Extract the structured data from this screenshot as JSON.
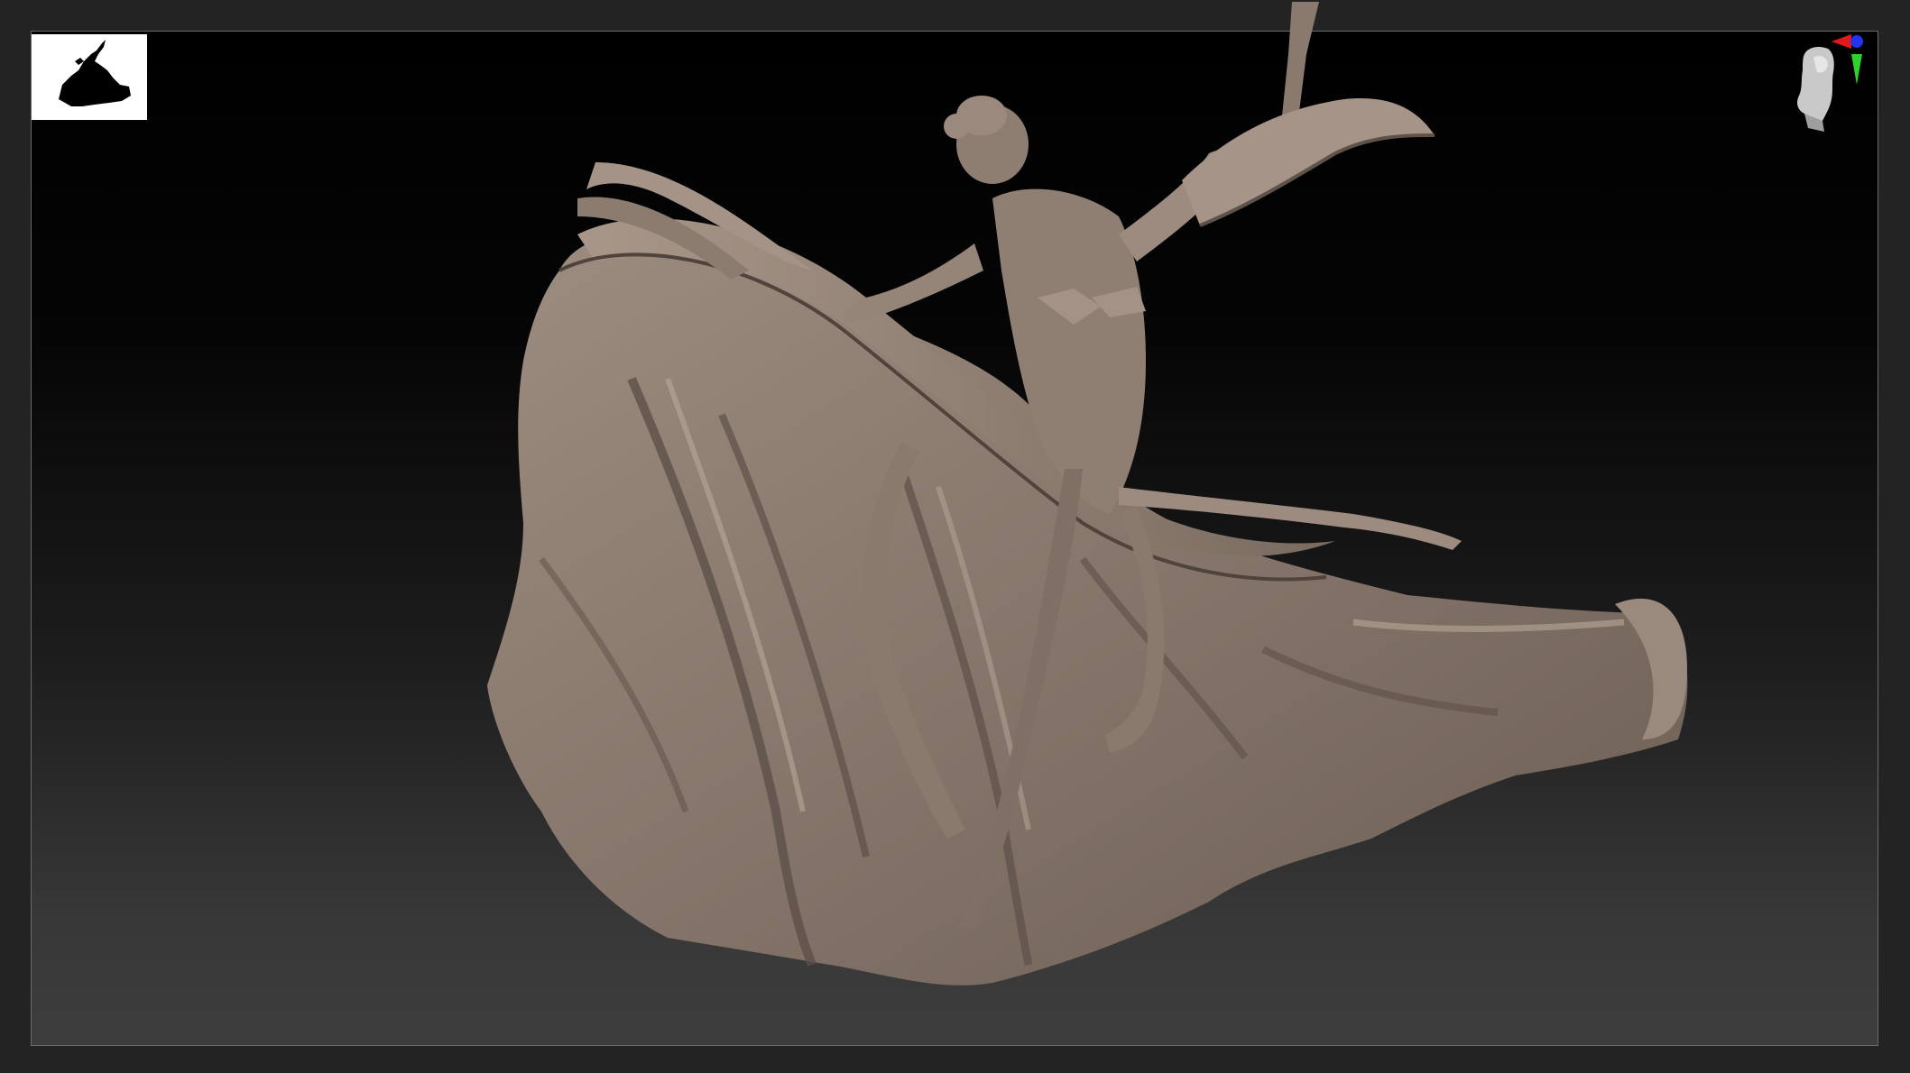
{
  "viewport": {
    "background_top": "#000000",
    "background_bottom": "#3d3d3d",
    "frame_color": "#6a6a6a"
  },
  "thumbnail": {
    "icon": "silhouette-thumbnail-icon",
    "background": "#ffffff"
  },
  "model": {
    "icon": "sculpt-model-figure",
    "material_color": "#8a7a6e",
    "shadow_color": "#3c332d",
    "highlight_color": "#b9a99c"
  },
  "navigation": {
    "icon": "head-orientation-gizmo-icon",
    "axis_colors": {
      "x": "#e0191d",
      "y": "#2fd12f",
      "z": "#2233ee"
    }
  }
}
